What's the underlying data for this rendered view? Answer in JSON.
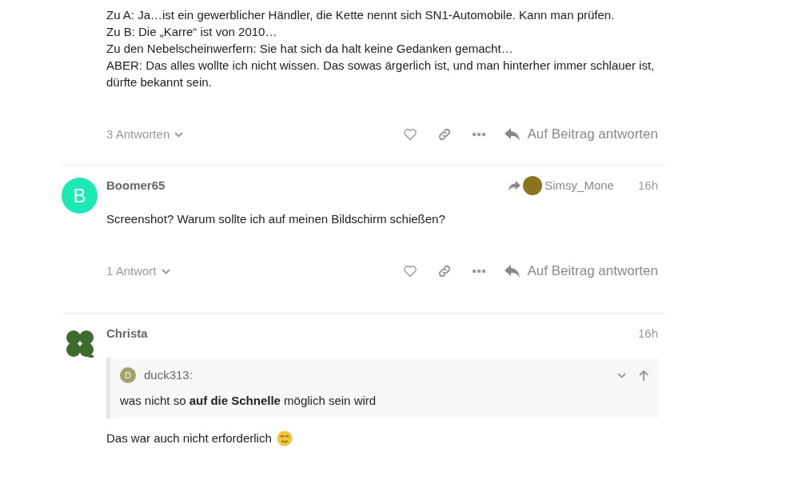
{
  "posts": [
    {
      "body": [
        "Zu A: Ja…ist ein gewerblicher Händler, die Kette nennt sich SN1-Automobile. Kann man prüfen.",
        "Zu B: Die „Karre“ ist von 2010…",
        "Zu den Nebelscheinwerfern: Sie hat sich da halt keine Gedanken gemacht…",
        "ABER: Das alles wollte ich nicht wissen. Das sowas ärgerlich ist, und man hinterher immer schlauer ist, dürfte bekannt sein."
      ],
      "replies_label": "3 Antworten",
      "reply_button": "Auf Beitrag antworten"
    },
    {
      "author": "Boomer65",
      "avatar": {
        "kind": "letter",
        "letter": "B"
      },
      "reply_to": "Simsy_Mone",
      "time": "16h",
      "body": [
        "Screenshot? Warum sollte ich auf meinen Bildschirm schießen?"
      ],
      "replies_label": "1 Antwort",
      "reply_button": "Auf Beitrag antworten"
    },
    {
      "author": "Christa",
      "avatar": {
        "kind": "image"
      },
      "time": "16h",
      "quote": {
        "author": "duck313:",
        "letter": "D",
        "text": "was nicht so **auf die Schnelle** möglich sein wird"
      },
      "body": [
        "Das war auch nicht erforderlich"
      ],
      "emoji": true
    }
  ]
}
